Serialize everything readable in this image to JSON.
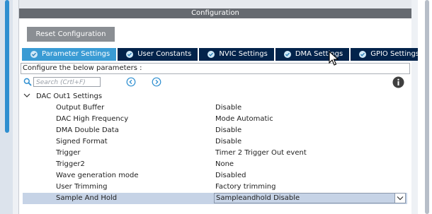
{
  "panel_title": "Configuration",
  "reset_button": "Reset Configuration",
  "tabs": [
    {
      "label": "Parameter Settings",
      "active": true
    },
    {
      "label": "User Constants",
      "active": false
    },
    {
      "label": "NVIC Settings",
      "active": false
    },
    {
      "label": "DMA Settings",
      "active": false
    },
    {
      "label": "GPIO Settings",
      "active": false
    }
  ],
  "description": "Configure the below parameters :",
  "search": {
    "placeholder": "Search (Crtl+F)"
  },
  "section": {
    "label": "DAC Out1 Settings",
    "expanded": true
  },
  "params": [
    {
      "name": "Output Buffer",
      "value": "Disable"
    },
    {
      "name": "DAC High Frequency",
      "value": "Mode Automatic"
    },
    {
      "name": "DMA Double Data",
      "value": "Disable"
    },
    {
      "name": "Signed Format",
      "value": "Disable"
    },
    {
      "name": "Trigger",
      "value": "Timer 2 Trigger Out event"
    },
    {
      "name": "Trigger2",
      "value": "None"
    },
    {
      "name": "Wave generation mode",
      "value": "Disabled"
    },
    {
      "name": "User Trimming",
      "value": "Factory trimming"
    },
    {
      "name": "Sample And Hold",
      "value": "Sampleandhold Disable",
      "selected": true
    }
  ],
  "colors": {
    "header": "#666a70",
    "tab_active": "#3a9bd4",
    "tab_inactive": "#03234b",
    "selected_row": "#c6d3e6",
    "accent": "#2f8fd0"
  },
  "icons": {
    "search": "search-icon",
    "prev": "chevron-left-circle-icon",
    "next": "chevron-right-circle-icon",
    "info": "info-icon",
    "section_toggle": "chevron-down-icon",
    "tab_check": "check-circle-icon",
    "dropdown": "chevron-down-icon",
    "cursor": "mouse-pointer-icon"
  }
}
